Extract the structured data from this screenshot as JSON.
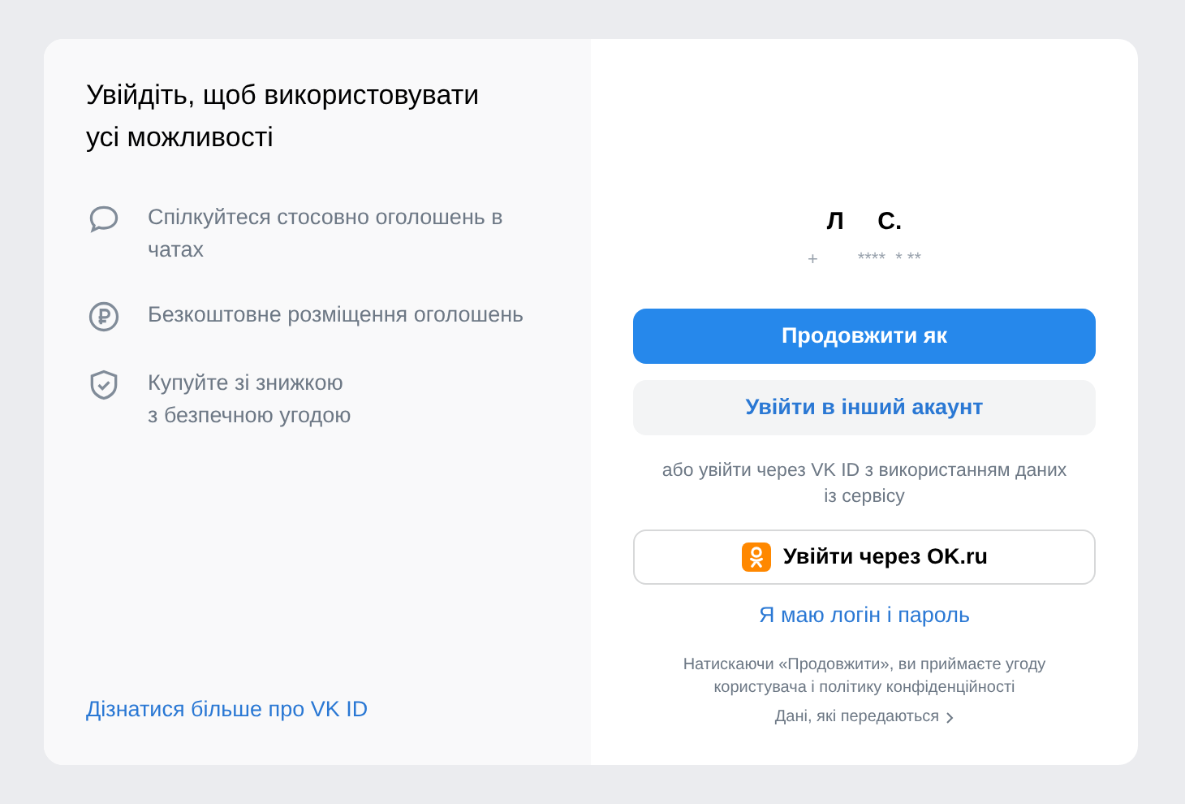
{
  "promo": {
    "title": "Увійдіть, щоб використовувати усі можливості",
    "features": [
      {
        "kind": "chat",
        "text": "Спілкуйтеся стосовно оголошень в чатах"
      },
      {
        "kind": "ruble",
        "text": "Безкоштовне розміщення оголошень"
      },
      {
        "kind": "shield",
        "text": "Купуйте зі знижкою\nз безпечною угодою"
      }
    ],
    "learn_more_link": "Дізнатися більше про VK ID"
  },
  "account": {
    "name": "Л     С.",
    "phone": "+        ****  * **"
  },
  "continue_button": "Продовжити як",
  "other_account_button": "Увійти в інший акаунт",
  "vk_id_note": "або увійти через VK ID з використанням даних\nіз сервісу",
  "ok_button": "Увійти через OK.ru",
  "login_password_link": "Я маю логін і пароль",
  "terms": "Натискаючи «Продовжити», ви приймаєте угоду\nкористувача і політику конфіденційності",
  "data_link": "Дані, які передаються"
}
